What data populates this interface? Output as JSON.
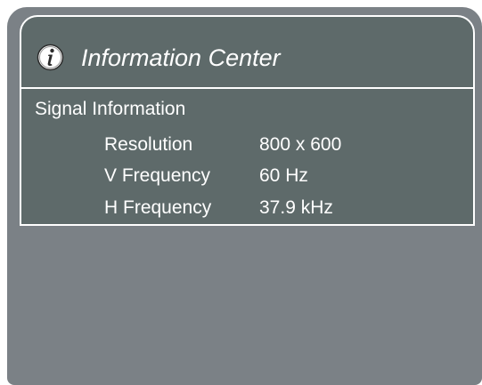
{
  "header": {
    "title": "Information Center",
    "icon": "info-icon"
  },
  "signal": {
    "section_label": "Signal Information",
    "rows": [
      {
        "label": "Resolution",
        "value": "800 x 600"
      },
      {
        "label": "V Frequency",
        "value": "60 Hz"
      },
      {
        "label": "H Frequency",
        "value": "37.9 kHz"
      }
    ]
  },
  "colors": {
    "panel": "#7b8186",
    "content": "#5e6a6a",
    "border": "#ffffff",
    "text": "#ffffff"
  }
}
